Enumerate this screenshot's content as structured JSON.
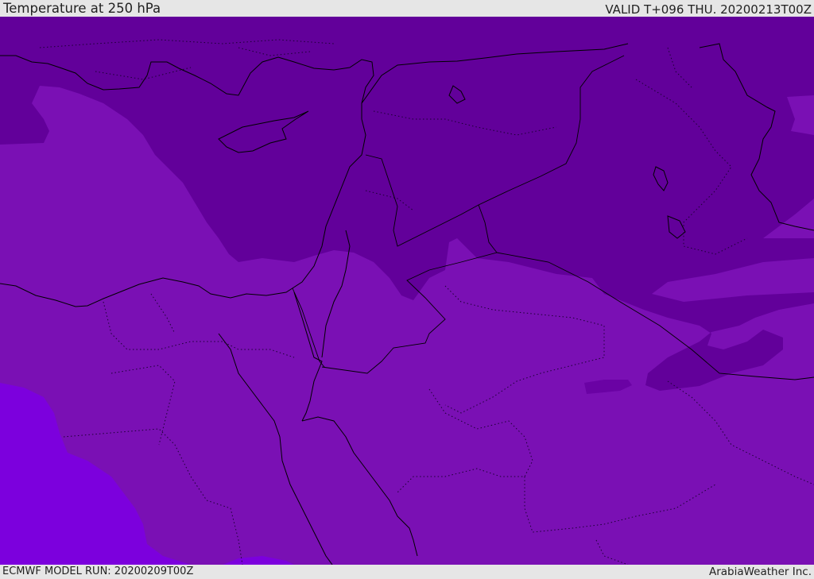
{
  "header": {
    "title": "Temperature at 250 hPa",
    "valid": "VALID T+096 THU. 20200213T00Z"
  },
  "footer": {
    "model_run": "ECMWF MODEL RUN: 20200209T00Z",
    "credit": "ArabiaWeather Inc."
  },
  "colors": {
    "band_dark": "#62009a",
    "band_mid": "#7a10b4",
    "band_light": "#7c00dd",
    "band_darker_patch": "#6a02a4",
    "outline": "#000000"
  }
}
